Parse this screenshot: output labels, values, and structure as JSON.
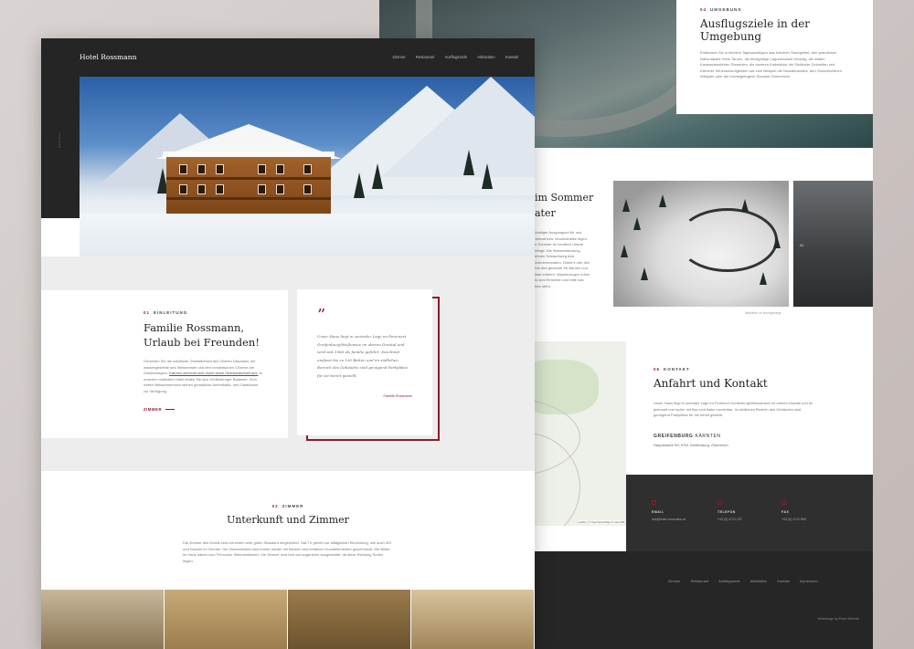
{
  "back": {
    "umgebung": {
      "num": "04",
      "label": "UMGEBUNG",
      "title": "Ausflugsziele in der Umgebung",
      "text": "Entdecken Sie in leichten Tagesausflügen das Kärntner Seengebiet, den grandiosen Nationalpark Hohe Tauern, die einzigartige Lagunenstadt Venedig, die wilden Karawankenfelder Slowenien, die bizarren Kalkstöcke der Südtiroler Dolomiten und Kärntner Sehenswürdigkeiten wie zum Beispiel die Nockalmstraße, den Gurkbrüchlinen Wildpark oder die höchstgelegene Stausee Österreichs."
    },
    "summer": {
      "title_line1": "im Sommer",
      "title_line2": "ater",
      "text": "günstiger Ausgangsort für und Fahrrad bzw. Mountainbike legen. Im Sommer ist vorallem Urlaub gefragt. Die Wasserstandung sehnen Schlachtweg eine Sommermonaten. Direkt in der den über den gesamte Tal Bauten und Hotel erleben. Wanderungen hoher bis zum Einsehen und bitte das oben steht."
    },
    "photo_caption": "Wandern im Hochgebirge",
    "photo2_num": "02",
    "map_attribution": "Leaflet | © OpenStreetMap & CartoDB",
    "kontakt": {
      "num": "06",
      "label": "KONTAKT",
      "title": "Anfahrt und Kontakt",
      "text": "Unser Haus liegt in zentraler Lage im Ferienort Greifenburg/Weissensee im oberen Drautal und ist jederzeit und sicher mit Bus und Bahn erreichbar. Im südlichen Bereich des Gebäudes sind genügend Parkplätze für sie bereit gestellt.",
      "city_bold": "GREIFENBURG",
      "city_rest": "KÄRNTEN",
      "address": "Hauptstraße 59, 9761 Greifenburg, Österreich"
    },
    "contact_cols": [
      {
        "title": "EMAIL",
        "value": "info@hotel-rossmann.at"
      },
      {
        "title": "TELEFON",
        "value": "+43 (0) 4712 237"
      },
      {
        "title": "FAX",
        "value": "+43 (0) 4712 659"
      }
    ],
    "footer_nav": [
      "Zimmer",
      "Restaurant",
      "Ausflugsziele",
      "Aktivitäten",
      "Kontakt",
      "Impressum"
    ],
    "footer_credit": "Webdesign by Peper Eternité"
  },
  "front": {
    "logo": "Hotel Rossmann",
    "nav": [
      "Zimmer",
      "Restaurant",
      "Ausflugsziele",
      "Aktivitäten",
      "Kontakt"
    ],
    "scroll": "SCROLL",
    "intro": {
      "num": "01",
      "label": "EINLEITUNG",
      "title_line1": "Familie Rossmann,",
      "title_line2": "Urlaub bei Freunden!",
      "text_before": "Genießen Sie die natürliche Gemütlichkeit des Oberen Drautales, die wassergedeihte des Weissensee und den romantischen Charme der Goldeckregion.",
      "text_link": "Kärnten zeichnet sich durch seine Seenlandschaft aus.",
      "text_after": "In unserem rustikalen Hotel finden Sie den Greifenburger Badesee. Zum netten Betsammensein stehen gemütliche Aufenthalts- und Gasträume zur Verfügung.",
      "link": "ZIMMER"
    },
    "quote": {
      "mark": "”",
      "text": "Unser Haus liegt in zentraler Lage im Ferienort Greifenburg/Weißensee im oberen Drautal und wird seit 1966 als familie geführt. Das Hotel umfasst bis zu 100 Betten und im südlichen Bereich des Gebäudes sind genügend Parkplätze für sie bereit gestellt.",
      "author": "Familie Rossmann"
    },
    "rooms": {
      "num": "02",
      "label": "ZIMMER",
      "title": "Unterkunft und Zimmer",
      "text": "Die Zimmer des Hotels sind mit einem sehr guten Standard eingerichtet. Sat-TV gehört zur alltäglichen Einrichtung, wie auch WC und Dusche im Zimmer. Die Zimmerhalten sind immer wieder mit Blumen und kreativen Kunstelementen geschmückt. Die Bilder im Haus haben zum Teil schon Seltenheitswert. Die Zimmer sind hell und angenehm ausgestattet, da diese Richtung Süden liegen."
    }
  },
  "colors": {
    "accent": "#8b1c2a",
    "dark": "#252525"
  }
}
